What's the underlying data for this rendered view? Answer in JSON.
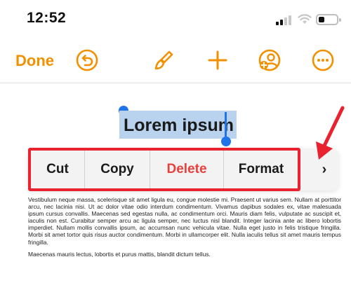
{
  "status_bar": {
    "time": "12:52",
    "signal_icon": "cellular-signal-icon",
    "wifi_icon": "wifi-icon",
    "battery_icon": "battery-low-icon"
  },
  "toolbar": {
    "done_label": "Done",
    "icons": [
      "undo-icon",
      "paintbrush-icon",
      "add-icon",
      "collaborate-icon",
      "more-icon"
    ],
    "accent_color": "#f39000"
  },
  "document": {
    "title": "Lorem ipsum",
    "selection_color": "#b9d3ee",
    "paragraphs": [
      "Vestibulum neque massa, scelerisque sit amet ligula eu, congue molestie mi. Praesent ut varius sem. Nullam at porttitor arcu, nec lacinia nisi. Ut ac dolor vitae odio interdum condimentum. Vivamus dapibus sodales ex, vitae malesuada ipsum cursus convallis. Maecenas sed egestas nulla, ac condimentum orci. Mauris diam felis, vulputate ac suscipit et, iaculis non est. Curabitur semper arcu ac ligula semper, nec luctus nisl blandit. Integer lacinia ante ac libero lobortis imperdiet. Nullam mollis convallis ipsum, ac accumsan nunc vehicula vitae. Nulla eget justo in felis tristique fringilla. Morbi sit amet tortor quis risus auctor condimentum. Morbi in ullamcorper elit. Nulla iaculis tellus sit amet mauris tempus fringilla.",
      "Maecenas mauris lectus, lobortis et purus mattis, blandit dictum tellus."
    ]
  },
  "edit_menu": {
    "items": [
      {
        "label": "Cut",
        "color": "#1a1a1a"
      },
      {
        "label": "Copy",
        "color": "#1a1a1a"
      },
      {
        "label": "Delete",
        "color": "#e8413c"
      },
      {
        "label": "Format",
        "color": "#1a1a1a"
      }
    ],
    "more_label": "›",
    "more_icon": "chevron-right-icon",
    "highlight_color": "#e8232f"
  },
  "annotation": {
    "arrow_icon": "red-arrow-icon",
    "arrow_color": "#e8232f"
  }
}
